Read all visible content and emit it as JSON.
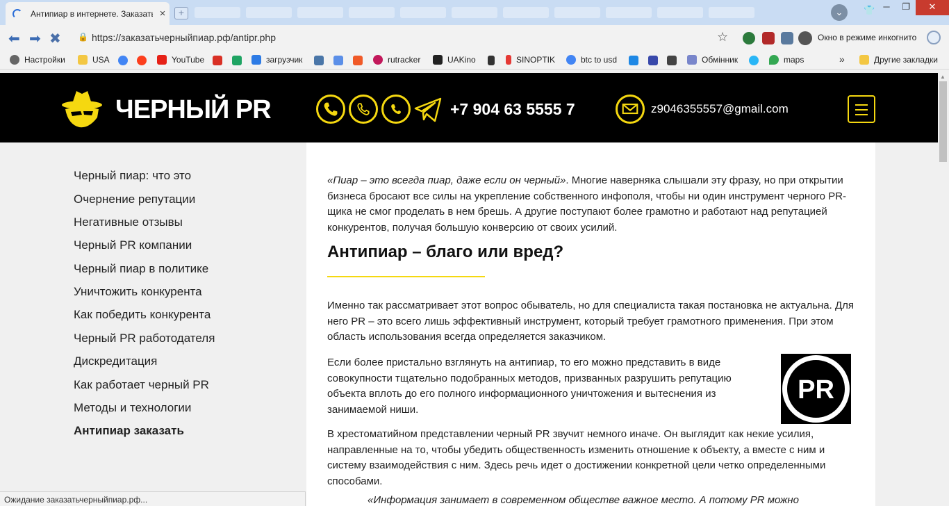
{
  "browser": {
    "tab_title": "Антипиар в интернете. Заказать а",
    "tab_close": "×",
    "new_tab": "+",
    "url": "https://заказатьчерныйпиар.рф/antipr.php",
    "incognito": "Окно в режиме инкогнито",
    "window": {
      "minimize": "─",
      "maximize": "❐",
      "close": "✕"
    },
    "status": "Ожидание заказатьчерныйпиар.рф..."
  },
  "bookmarks": [
    {
      "label": "Настройки"
    },
    {
      "label": "USA"
    },
    {
      "label": "YouTube"
    },
    {
      "label": "загрузчик"
    },
    {
      "label": "rutracker"
    },
    {
      "label": "UAKino"
    },
    {
      "label": "SINOPTIK"
    },
    {
      "label": "btc to usd"
    },
    {
      "label": "Обмінник"
    },
    {
      "label": "maps"
    },
    {
      "label": "Другие закладки"
    }
  ],
  "site": {
    "logo": "ЧЕРНЫЙ PR",
    "phone": "+7 904 63 5555 7",
    "email": "z9046355557@gmail.com"
  },
  "sidebar": {
    "items": [
      "Черный пиар: что это",
      "Очернение репутации",
      "Негативные отзывы",
      "Черный PR компании",
      "Черный пиар в политике",
      "Уничтожить конкурента",
      "Как победить конкурента",
      "Черный PR работодателя",
      "Дискредитация",
      "Как работает черный PR",
      "Методы и технологии",
      "Антипиар заказать"
    ]
  },
  "article": {
    "intro_quote": "«Пиар – это всегда пиар, даже если он черный»",
    "intro_rest": ". Многие наверняка слышали эту фразу, но при открытии бизнеса бросают все силы на укрепление собственного инфополя, чтобы ни один инструмент черного PR-щика не смог проделать в нем брешь. А другие поступают более грамотно и работают над репутацией конкурентов, получая большую конверсию от своих усилий.",
    "heading": "Антипиар – благо или вред?",
    "para1": "Именно так рассматривает этот вопрос обыватель, но для специалиста такая постановка не актуальна. Для него PR – это всего лишь эффективный инструмент, который требует грамотного применения. При этом область использования всегда определяется заказчиком.",
    "para2": "Если более пристально взглянуть на антипиар, то его можно представить в виде совокупности тщательно подобранных методов, призванных разрушить репутацию объекта вплоть до его полного информационного уничтожения и вытеснения из занимаемой ниши.",
    "para3": "В хрестоматийном представлении черный PR звучит немного иначе. Он выглядит как некие усилия, направленные на то, чтобы убедить общественность изменить отношение к объекту, а вместе с ним и систему взаимодействия с ним. Здесь речь идет о достижении конкретной цели четко определенными способами.",
    "quote_cut": "«Информация занимает в современном обществе важное место. А потому PR можно",
    "pr_badge": "PR"
  }
}
